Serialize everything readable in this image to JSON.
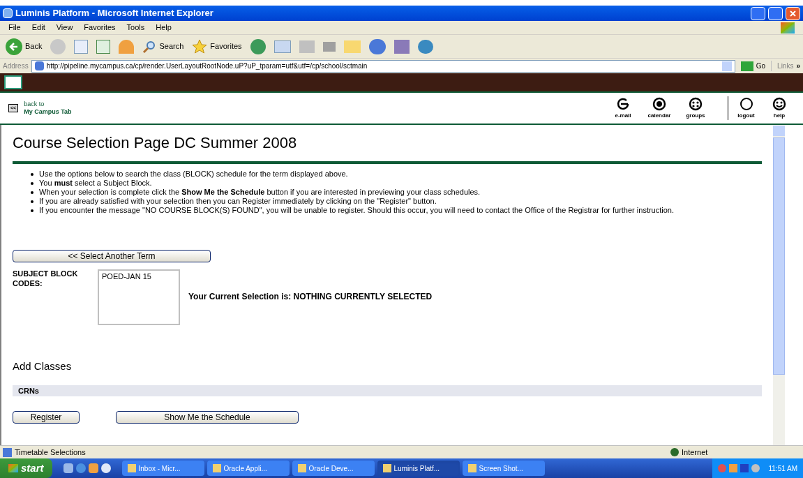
{
  "window": {
    "title": "Luminis Platform - Microsoft Internet Explorer"
  },
  "menu": [
    "File",
    "Edit",
    "View",
    "Favorites",
    "Tools",
    "Help"
  ],
  "toolbar": {
    "back": "Back",
    "search": "Search",
    "favorites": "Favorites"
  },
  "address": {
    "label": "Address",
    "url": "http://pipeline.mycampus.ca/cp/render.UserLayoutRootNode.uP?uP_tparam=utf&utf=/cp/school/sctmain",
    "go": "Go",
    "links": "Links",
    "more": "»"
  },
  "portal": {
    "back_line1": "back to",
    "back_line2": "My Campus Tab",
    "back_key": "<<",
    "icons": [
      {
        "kind": "email",
        "label": "e-mail"
      },
      {
        "kind": "calendar",
        "label": "calendar"
      },
      {
        "kind": "groups",
        "label": "groups"
      },
      {
        "kind": "logout",
        "label": "logout"
      },
      {
        "kind": "help",
        "label": "help"
      }
    ]
  },
  "page": {
    "title": "Course Selection Page DC Summer 2008",
    "bullets": [
      "Use the options below to search the class (BLOCK) schedule for the term displayed above.",
      "You **must** select a Subject Block.",
      "When your selection is complete click the **Show Me the Schedule** button if you are interested in previewing your class schedules.",
      "If you are already satisfied with your selection then you can Register immediately by clicking on the \"Register\" button.",
      "If you encounter the message \"NO COURSE BLOCK(S) FOUND\", you will be unable to register. Should this occur, you will need to contact the Office of the Registrar for further instruction."
    ],
    "select_term_button": "<< Select Another Term",
    "subject_label": "SUBJECT BLOCK CODES:",
    "subject_options": [
      {
        "label": "POED-JAN 15",
        "selected": false
      }
    ],
    "current_selection": "Your Current Selection is: NOTHING CURRENTLY SELECTED",
    "add_classes": "Add Classes",
    "crns": "CRNs",
    "buttons": [
      "Register",
      "Show Me the Schedule"
    ]
  },
  "status_bar": {
    "text": "Timetable Selections",
    "zone": "Internet"
  },
  "taskbar": {
    "start": "start",
    "clock": "11:51 AM",
    "tasks": [
      {
        "label": "Inbox - Micr...",
        "selected": false
      },
      {
        "label": "Oracle Appli...",
        "selected": false
      },
      {
        "label": "Oracle Deve...",
        "selected": false
      },
      {
        "label": "Luminis Platf...",
        "selected": true
      },
      {
        "label": "Screen Shot...",
        "selected": false
      }
    ]
  }
}
